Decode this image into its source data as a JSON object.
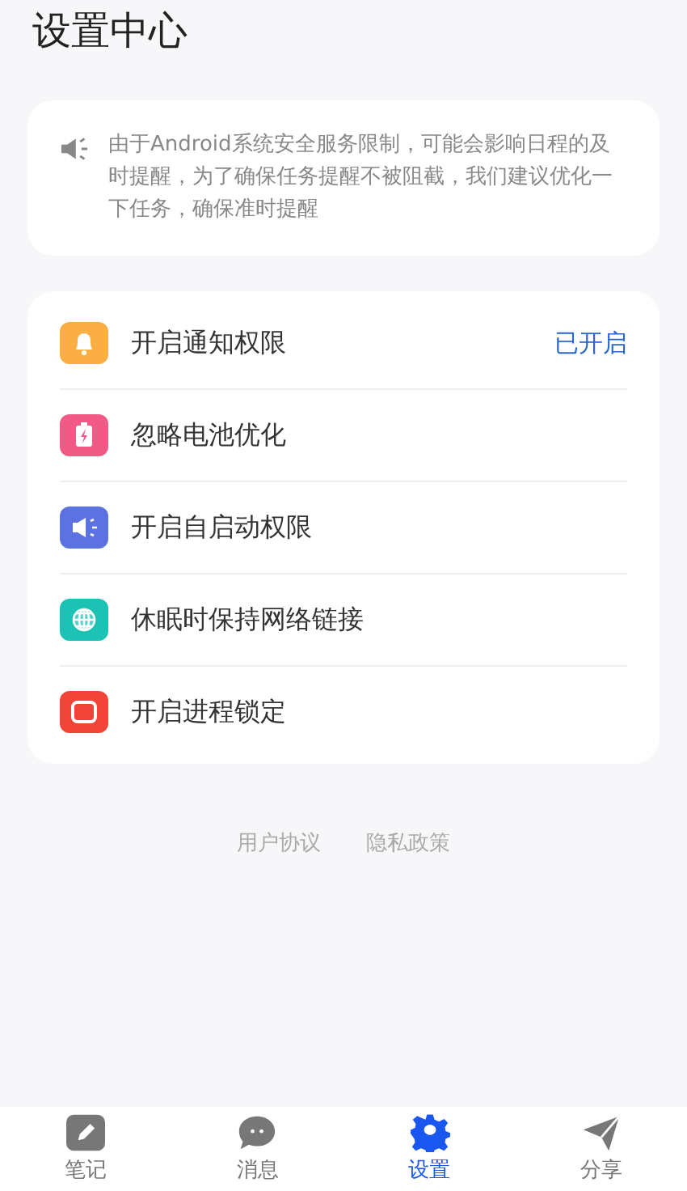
{
  "title": "设置中心",
  "notice": {
    "text": "由于Android系统安全服务限制，可能会影响日程的及时提醒，为了确保任务提醒不被阻截，我们建议优化一下任务，确保准时提醒"
  },
  "settings": [
    {
      "kind": "bell",
      "label": "开启通知权限",
      "color": "#fbae44",
      "status": "已开启"
    },
    {
      "kind": "battery",
      "label": "忽略电池优化",
      "color": "#f15a86"
    },
    {
      "kind": "speaker",
      "label": "开启自启动权限",
      "color": "#5b72e0"
    },
    {
      "kind": "globe",
      "label": "休眠时保持网络链接",
      "color": "#1cc3b4"
    },
    {
      "kind": "lock",
      "label": "开启进程锁定",
      "color": "#f24338"
    }
  ],
  "links": [
    "用户协议",
    "隐私政策"
  ],
  "tabs": [
    {
      "kind": "pencil",
      "label": "笔记",
      "selected": false
    },
    {
      "kind": "chat",
      "label": "消息",
      "selected": false
    },
    {
      "kind": "gear",
      "label": "设置",
      "selected": true
    },
    {
      "kind": "send",
      "label": "分享",
      "selected": false
    }
  ]
}
